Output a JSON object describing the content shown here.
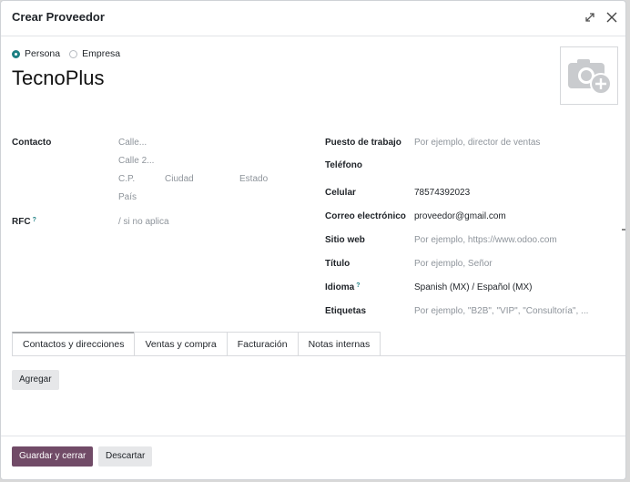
{
  "dialog": {
    "title": "Crear Proveedor"
  },
  "partner_type": {
    "options": [
      "Persona",
      "Empresa"
    ],
    "selected": "Persona"
  },
  "name": "TecnoPlus",
  "address": {
    "label": "Contacto",
    "street_placeholder": "Calle...",
    "street2_placeholder": "Calle 2...",
    "zip_placeholder": "C.P.",
    "city_placeholder": "Ciudad",
    "state_placeholder": "Estado",
    "country_placeholder": "País"
  },
  "rfc": {
    "label": "RFC",
    "help": "?",
    "placeholder": "/ si no aplica"
  },
  "right_fields": {
    "job_label": "Puesto de trabajo",
    "job_placeholder": "Por ejemplo, director de ventas",
    "phone_label": "Teléfono",
    "mobile_label": "Celular",
    "mobile_value": "78574392023",
    "email_label": "Correo electrónico",
    "email_value": "proveedor@gmail.com",
    "website_label": "Sitio web",
    "website_placeholder": "Por ejemplo, https://www.odoo.com",
    "title_label": "Título",
    "title_placeholder": "Por ejemplo, Señor",
    "lang_label": "Idioma",
    "lang_help": "?",
    "lang_value": "Spanish (MX) / Español (MX)",
    "tags_label": "Etiquetas",
    "tags_placeholder": "Por ejemplo, \"B2B\", \"VIP\", \"Consultoría\", ..."
  },
  "tabs": [
    {
      "label": "Contactos y direcciones",
      "active": true
    },
    {
      "label": "Ventas y compra",
      "active": false
    },
    {
      "label": "Facturación",
      "active": false
    },
    {
      "label": "Notas internas",
      "active": false
    }
  ],
  "add_button": "Agregar",
  "footer": {
    "save_label": "Guardar y cerrar",
    "discard_label": "Descartar"
  },
  "icons": [
    "expand-icon",
    "close-icon",
    "camera-plus-icon"
  ],
  "colors": {
    "accent": "#1d7f83",
    "primary_button": "#714b67"
  }
}
